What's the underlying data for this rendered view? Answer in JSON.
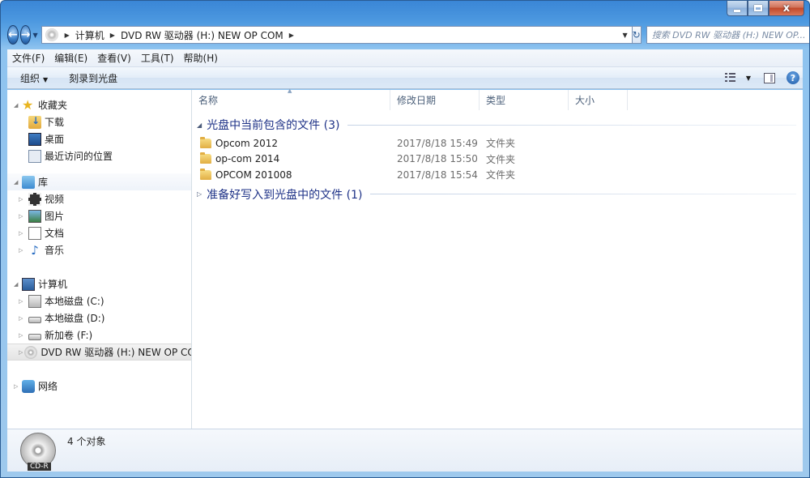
{
  "window": {
    "caption": {
      "minimize": "",
      "maximize": "",
      "close": "x"
    }
  },
  "nav": {
    "breadcrumbs": [
      "计算机",
      "DVD RW 驱动器 (H:) NEW OP COM"
    ],
    "search_placeholder": "搜索 DVD RW 驱动器 (H:) NEW OP..."
  },
  "menubar": {
    "items": [
      "文件(F)",
      "编辑(E)",
      "查看(V)",
      "工具(T)",
      "帮助(H)"
    ]
  },
  "commandbar": {
    "organize": "组织",
    "burn": "刻录到光盘"
  },
  "navpane": {
    "favorites": {
      "label": "收藏夹",
      "items": [
        "下载",
        "桌面",
        "最近访问的位置"
      ]
    },
    "libraries": {
      "label": "库",
      "items": [
        "视频",
        "图片",
        "文档",
        "音乐"
      ]
    },
    "computer": {
      "label": "计算机",
      "items": [
        "本地磁盘 (C:)",
        "本地磁盘 (D:)",
        "新加卷 (F:)",
        "DVD RW 驱动器 (H:) NEW OP COM"
      ]
    },
    "network": {
      "label": "网络"
    }
  },
  "columns": {
    "name": "名称",
    "date": "修改日期",
    "type": "类型",
    "size": "大小"
  },
  "groups": [
    {
      "title": "光盘中当前包含的文件 (3)",
      "files": [
        {
          "name": "Opcom 2012",
          "date": "2017/8/18 15:49",
          "type": "文件夹"
        },
        {
          "name": "op-com 2014",
          "date": "2017/8/18 15:50",
          "type": "文件夹"
        },
        {
          "name": "OPCOM 201008",
          "date": "2017/8/18 15:54",
          "type": "文件夹"
        }
      ]
    },
    {
      "title": "准备好写入到光盘中的文件 (1)"
    }
  ],
  "details": {
    "count": "4 个对象",
    "disc_label": "CD-R"
  }
}
